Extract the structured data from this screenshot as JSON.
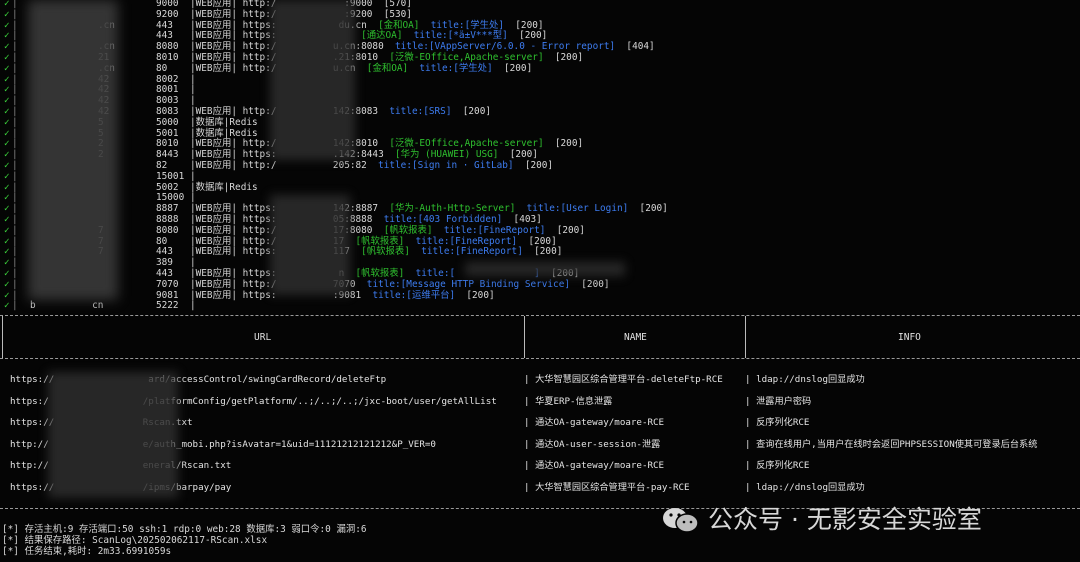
{
  "scan_rows": [
    {
      "ip": "",
      "port": "9000",
      "info": [
        [
          "w",
          "|WEB应用| http:/"
        ],
        [
          "w",
          "            :9000  [570]"
        ]
      ]
    },
    {
      "ip": "",
      "port": "9200",
      "info": [
        [
          "w",
          "|WEB应用| http:/"
        ],
        [
          "w",
          "            :9200  [530]"
        ]
      ]
    },
    {
      "ip": ".cn",
      "port": "443",
      "info": [
        [
          "w",
          "|WEB应用| https:"
        ],
        [
          "w",
          "           du.cn  "
        ],
        [
          "g",
          "[金和OA]"
        ],
        [
          "b",
          "  title:[学生处]"
        ],
        [
          "w",
          "  [200]"
        ]
      ]
    },
    {
      "ip": "",
      "port": "443",
      "info": [
        [
          "w",
          "|WEB应用| https:"
        ],
        [
          "g",
          "               [通达OA]"
        ],
        [
          "b",
          "  title:[*ä±V***型]"
        ],
        [
          "w",
          "  [200]"
        ]
      ]
    },
    {
      "ip": ".cn",
      "port": "8080",
      "info": [
        [
          "w",
          "|WEB应用| http:/"
        ],
        [
          "w",
          "          u.cn:8080  "
        ],
        [
          "b",
          "title:[VAppServer/6.0.0 - Error report]"
        ],
        [
          "w",
          "  [404]"
        ]
      ]
    },
    {
      "ip": "21",
      "port": "8010",
      "info": [
        [
          "w",
          "|WEB应用| http:/"
        ],
        [
          "w",
          "          .21:8010  "
        ],
        [
          "g",
          "[泛微-EOffice,Apache-server]"
        ],
        [
          "w",
          "  [200]"
        ]
      ]
    },
    {
      "ip": ".cn",
      "port": "80",
      "info": [
        [
          "w",
          "|WEB应用| http:/"
        ],
        [
          "w",
          "          u.cn  "
        ],
        [
          "g",
          "[金和OA]"
        ],
        [
          "b",
          "  title:[学生处]"
        ],
        [
          "w",
          "  [200]"
        ]
      ]
    },
    {
      "ip": "42",
      "port": "8002",
      "info": [
        [
          "w",
          "|"
        ]
      ]
    },
    {
      "ip": "42",
      "port": "8001",
      "info": [
        [
          "w",
          "|"
        ]
      ]
    },
    {
      "ip": "42",
      "port": "8003",
      "info": [
        [
          "w",
          "|"
        ]
      ]
    },
    {
      "ip": "42",
      "port": "8083",
      "info": [
        [
          "w",
          "|WEB应用| http:/"
        ],
        [
          "w",
          "          142:8083  "
        ],
        [
          "b",
          "title:[SRS]"
        ],
        [
          "w",
          "  [200]"
        ]
      ]
    },
    {
      "ip": "5",
      "port": "5000",
      "info": [
        [
          "w",
          "|数据库|Redis"
        ]
      ]
    },
    {
      "ip": "5",
      "port": "5001",
      "info": [
        [
          "w",
          "|数据库|Redis"
        ]
      ]
    },
    {
      "ip": "2",
      "port": "8010",
      "info": [
        [
          "w",
          "|WEB应用| http:/"
        ],
        [
          "w",
          "          142:8010  "
        ],
        [
          "g",
          "[泛微-EOffice,Apache-server]"
        ],
        [
          "w",
          "  [200]"
        ]
      ]
    },
    {
      "ip": "2",
      "port": "8443",
      "info": [
        [
          "w",
          "|WEB应用| https:"
        ],
        [
          "w",
          "          .142:8443  "
        ],
        [
          "g",
          "[华为 (HUAWEI) USG]"
        ],
        [
          "w",
          "  [200]"
        ]
      ]
    },
    {
      "ip": "",
      "port": "82",
      "info": [
        [
          "w",
          "|WEB应用| http:/"
        ],
        [
          "w",
          "          205:82  "
        ],
        [
          "b",
          "title:[Sign in · GitLab]"
        ],
        [
          "w",
          "  [200]"
        ]
      ]
    },
    {
      "ip": "",
      "port": "15001",
      "info": [
        [
          "w",
          "|"
        ]
      ]
    },
    {
      "ip": "",
      "port": "5002",
      "info": [
        [
          "w",
          "|数据库|Redis"
        ]
      ]
    },
    {
      "ip": "",
      "port": "15000",
      "info": [
        [
          "w",
          "|"
        ]
      ]
    },
    {
      "ip": "",
      "port": "8887",
      "info": [
        [
          "w",
          "|WEB应用| https:"
        ],
        [
          "w",
          "          142:8887  "
        ],
        [
          "g",
          "[华为-Auth-Http-Server]"
        ],
        [
          "b",
          "  title:[User Login]"
        ],
        [
          "w",
          "  [200]"
        ]
      ]
    },
    {
      "ip": "",
      "port": "8888",
      "info": [
        [
          "w",
          "|WEB应用| https:"
        ],
        [
          "w",
          "          05:8888  "
        ],
        [
          "b",
          "title:[403 Forbidden]"
        ],
        [
          "w",
          "  [403]"
        ]
      ]
    },
    {
      "ip": "7",
      "port": "8080",
      "info": [
        [
          "w",
          "|WEB应用| http:/"
        ],
        [
          "w",
          "          17:8080  "
        ],
        [
          "g",
          "[帆软报表]"
        ],
        [
          "b",
          "  title:[FineReport]"
        ],
        [
          "w",
          "  [200]"
        ]
      ]
    },
    {
      "ip": "7",
      "port": "80",
      "info": [
        [
          "w",
          "|WEB应用| http:/"
        ],
        [
          "w",
          "          17  "
        ],
        [
          "g",
          "[帆软报表]"
        ],
        [
          "b",
          "  title:[FineReport]"
        ],
        [
          "w",
          "  [200]"
        ]
      ]
    },
    {
      "ip": "7",
      "port": "443",
      "info": [
        [
          "w",
          "|WEB应用| https:"
        ],
        [
          "w",
          "          117  "
        ],
        [
          "g",
          "[帆软报表]"
        ],
        [
          "b",
          "  title:[FineReport]"
        ],
        [
          "w",
          "  [200]"
        ]
      ]
    },
    {
      "ip": "",
      "port": "389",
      "info": [
        [
          "w",
          "|"
        ]
      ]
    },
    {
      "ip": "",
      "port": "443",
      "info": [
        [
          "w",
          "|WEB应用| https:"
        ],
        [
          "w",
          "           n  "
        ],
        [
          "g",
          "[帆软报表]"
        ],
        [
          "b",
          "  title:[              ]"
        ],
        [
          "w",
          "  [200]"
        ]
      ]
    },
    {
      "ip": "",
      "port": "7070",
      "info": [
        [
          "w",
          "|WEB应用| http:/"
        ],
        [
          "w",
          "          7070  "
        ],
        [
          "b",
          "title:[Message HTTP Binding Service]"
        ],
        [
          "w",
          "  [200]"
        ]
      ]
    },
    {
      "ip": "",
      "port": "9081",
      "info": [
        [
          "w",
          "|WEB应用| https:"
        ],
        [
          "w",
          "          :9081  "
        ],
        [
          "b",
          "title:[运维平台]"
        ],
        [
          "w",
          "  [200]"
        ]
      ]
    },
    {
      "ip": "b          cn",
      "port": "5222",
      "info": [
        [
          "w",
          "|"
        ]
      ]
    }
  ],
  "vuln_table": {
    "headers": {
      "url": "URL",
      "name": "NAME",
      "info": "INFO"
    },
    "rows": [
      {
        "url": "https://                 ard/accessControl/swingCardRecord/deleteFtp",
        "name": "| 大华智慧园区综合管理平台-deleteFtp-RCE",
        "info": "| ldap://dnslog回显成功"
      },
      {
        "url": "https:/                 /platformConfig/getPlatform/..;/..;/..;/jxc-boot/user/getAllList",
        "name": "| 华夏ERP-信息泄露",
        "info": "| 泄露用户密码"
      },
      {
        "url": "https://                Rscan.txt",
        "name": "| 通达OA-gateway/moare-RCE",
        "info": "| 反序列化RCE"
      },
      {
        "url": "http://                 e/auth_mobi.php?isAvatar=1&uid=11121212121212&P_VER=0",
        "name": "| 通达OA-user-session-泄露",
        "info": "| 查询在线用户,当用户在线时会返回PHPSESSION使其可登录后台系统"
      },
      {
        "url": "http://                 eneral/Rscan.txt",
        "name": "| 通达OA-gateway/moare-RCE",
        "info": "| 反序列化RCE"
      },
      {
        "url": "https://                /ipms/barpay/pay",
        "name": "| 大华智慧园区综合管理平台-pay-RCE",
        "info": "| ldap://dnslog回显成功"
      }
    ]
  },
  "footer": {
    "line1": "[*] 存活主机:9 存活端口:50 ssh:1 rdp:0 web:28 数据库:3 弱口令:0 漏洞:6",
    "line2": "[*] 结果保存路径: ScanLog\\202502062117-RScan.xlsx",
    "line3": "[*] 任务结束,耗时: 2m33.6991059s"
  },
  "watermark": {
    "text": "公众号 · 无影安全实验室",
    "icon": "wechat-icon"
  },
  "colors": {
    "ok": "#2fc12f",
    "title": "#3d7cf0",
    "background": "#050505"
  }
}
